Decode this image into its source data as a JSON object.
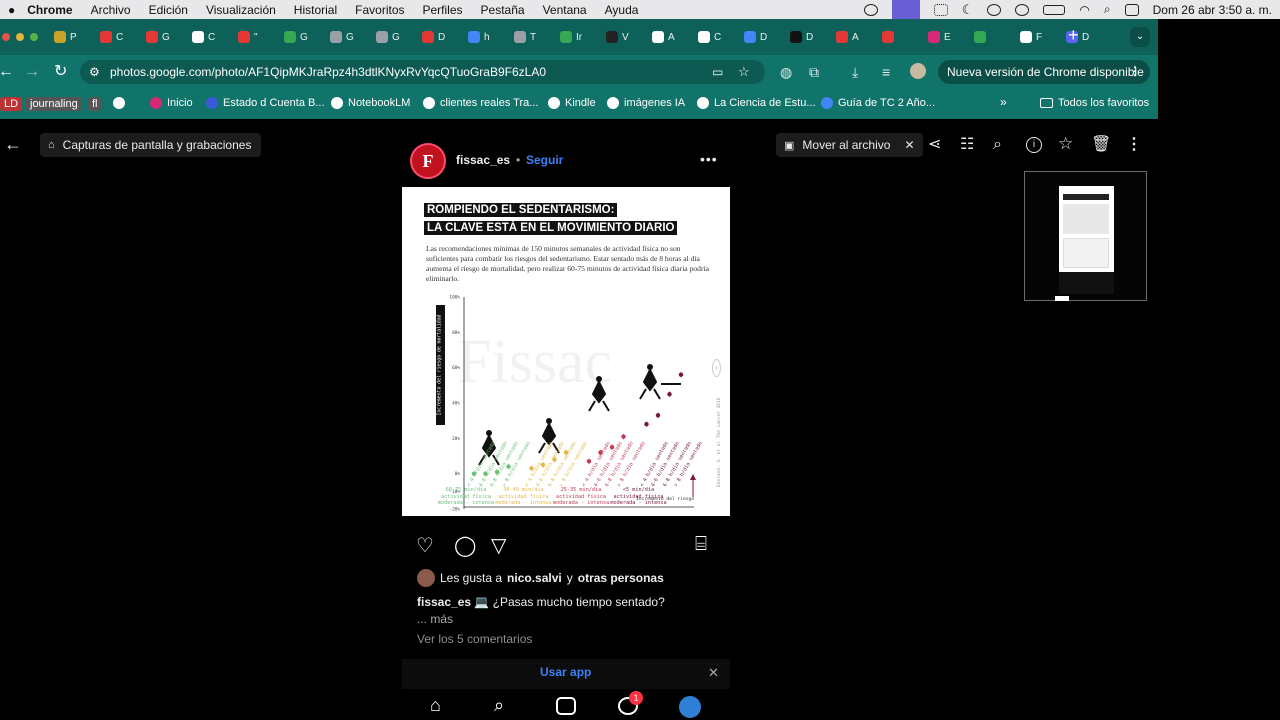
{
  "menubar": {
    "app": "Chrome",
    "items": [
      "Archivo",
      "Edición",
      "Visualización",
      "Historial",
      "Favoritos",
      "Perfiles",
      "Pestaña",
      "Ventana",
      "Ayuda"
    ],
    "clock": "Dom 26 abr  3:50 a. m."
  },
  "tabs": [
    {
      "label": "P",
      "color": "#c9a227"
    },
    {
      "label": "C",
      "color": "#e53935"
    },
    {
      "label": "G",
      "color": "#e53935"
    },
    {
      "label": "C",
      "color": "#ffffff"
    },
    {
      "label": "\"",
      "color": "#e53935"
    },
    {
      "label": "G",
      "color": "#34a853"
    },
    {
      "label": "G",
      "color": "#9aa0a6"
    },
    {
      "label": "G",
      "color": "#9aa0a6"
    },
    {
      "label": "D",
      "color": "#e53935"
    },
    {
      "label": "h",
      "color": "#4285f4"
    },
    {
      "label": "T",
      "color": "#9aa0a6"
    },
    {
      "label": "Ir",
      "color": "#34a853"
    },
    {
      "label": "V",
      "color": "#222222"
    },
    {
      "label": "A",
      "color": "#ffffff"
    },
    {
      "label": "C",
      "color": "#ffffff"
    },
    {
      "label": "D",
      "color": "#4285f4"
    },
    {
      "label": "D",
      "color": "#111111"
    },
    {
      "label": "A",
      "color": "#e53935"
    },
    {
      "label": "",
      "color": "#e53935"
    },
    {
      "label": "E",
      "color": "#d62976"
    },
    {
      "label": "",
      "color": "#34a853"
    },
    {
      "label": "F",
      "color": "#ffffff"
    },
    {
      "label": "D",
      "color": "#5865f2"
    }
  ],
  "omnibox": {
    "url": "photos.google.com/photo/AF1QipMKJraRpz4h3dtlKNyxRvYqcQTuoGraB9F6zLA0",
    "update_label": "Nueva versión de Chrome disponible"
  },
  "bookmarks": {
    "items": [
      {
        "label": "LD",
        "color": "#d33"
      },
      {
        "label": "journaling",
        "color": "#999"
      },
      {
        "label": "fl",
        "color": "#c9a227"
      },
      {
        "label": "",
        "color": "#fff"
      },
      {
        "label": "Inicio",
        "color": "#d62976"
      },
      {
        "label": "Estado d Cuenta B...",
        "color": "#3a5bd9"
      },
      {
        "label": "NotebookLM",
        "color": "#fff"
      },
      {
        "label": "clientes reales Tra...",
        "color": "#fff"
      },
      {
        "label": "Kindle",
        "color": "#fff"
      },
      {
        "label": "imágenes IA",
        "color": "#fff"
      },
      {
        "label": "La Ciencia de Estu...",
        "color": "#fff"
      },
      {
        "label": "Guía de TC 2 Año...",
        "color": "#4285f4"
      }
    ],
    "all_label": "Todos los favoritos"
  },
  "viewer": {
    "album_chip": "Capturas de pantalla y grabaciones",
    "archive_label": "Mover al archivo"
  },
  "post": {
    "avatar_letter": "F",
    "username": "fissac_es",
    "separator": "•",
    "follow_label": "Seguir",
    "headline1": "ROMPIENDO EL SEDENTARISMO:",
    "headline2": "LA CLAVE ESTÁ EN EL MOVIMIENTO DIARIO",
    "body": "Las recomendaciones mínimas de 150 minutos semanales de actividad física no son suficientes para combatir los riesgos del sedentarismo. Estar sentado más de 8 horas al día aumenta el riesgo de mortalidad, pero realizar 60-75 minutos de actividad física diaria podría eliminarlo.",
    "watermark": "Fissac",
    "likes_prefix": "Les gusta a",
    "likes_user": "nico.salvi",
    "likes_mid": "y",
    "likes_others": "otras personas",
    "caption_user": "fissac_es",
    "caption_text": "💻 ¿Pasas mucho tiempo sentado?",
    "more_label": "... más",
    "comments_label": "Ver los 5 comentarios",
    "use_app_label": "Usar app",
    "notif_count": "1"
  },
  "chart_data": {
    "type": "scatter",
    "ylabel": "Incremento del riesgo de mortalidad",
    "annotation": "Incremento del riesgo",
    "source": "Ekelund, U. et al The Lancet 2016",
    "yticks": [
      "100%",
      "80%",
      "60%",
      "40%",
      "20%",
      "0%",
      "-10%",
      "-20%"
    ],
    "groups": [
      {
        "name": "60-75 min/día\nactividad física\nmoderada - intensa",
        "color": "#6bbf7a"
      },
      {
        "name": "30-40 min/día\nactividad física\nmoderada - intensa",
        "color": "#e0b84a"
      },
      {
        "name": "25-35 min/día\nactividad física\nmoderada - intensa",
        "color": "#c23b52"
      },
      {
        "name": "<5 min/día\nactividad física\nmoderada - intensa",
        "color": "#7a1630"
      }
    ],
    "categories": [
      "< 4 h/día sentado",
      "4-6 h/día sentado",
      "6-8 h/día sentado",
      "> 8 h/día sentado"
    ],
    "series": [
      {
        "values": [
          0,
          0,
          1,
          4
        ]
      },
      {
        "values": [
          3,
          5,
          8,
          12
        ]
      },
      {
        "values": [
          7,
          12,
          15,
          21
        ]
      },
      {
        "values": [
          28,
          33,
          45,
          56
        ]
      }
    ],
    "ylim": [
      -20,
      100
    ]
  }
}
